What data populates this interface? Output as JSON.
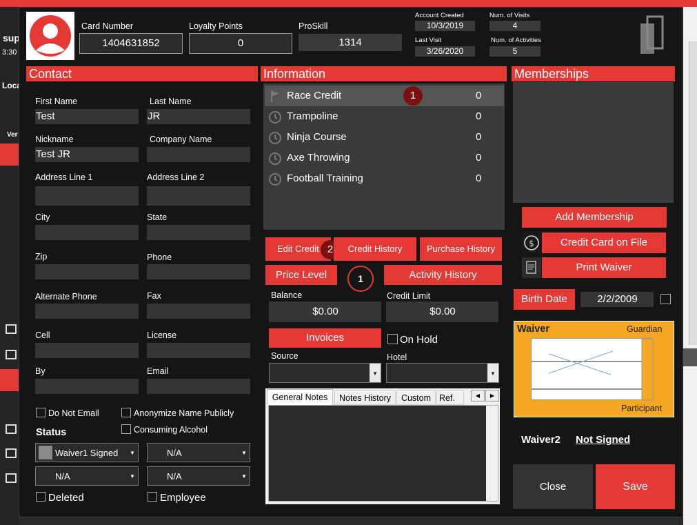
{
  "background": {
    "bg_text_1": "sup",
    "bg_text_2": "3:30",
    "bg_text_3": "Loca",
    "bg_text_4": "Ver"
  },
  "header": {
    "card_number_label": "Card Number",
    "card_number": "1404631852",
    "loyalty_label": "Loyalty Points",
    "loyalty": "0",
    "proskill_label": "ProSkill",
    "proskill": "1314",
    "account_created_label": "Account Created",
    "account_created": "10/3/2019",
    "last_visit_label": "Last Visit",
    "last_visit": "3/26/2020",
    "num_visits_label": "Num. of Visits",
    "num_visits": "4",
    "num_activities_label": "Num. of Activities",
    "num_activities": "5"
  },
  "contact": {
    "title": "Contact",
    "first_name_label": "First Name",
    "first_name": "Test",
    "last_name_label": "Last Name",
    "last_name": "JR",
    "nickname_label": "Nickname",
    "nickname": "Test JR",
    "company_label": "Company Name",
    "company": "",
    "address1_label": "Address Line 1",
    "address2_label": "Address Line 2",
    "city_label": "City",
    "state_label": "State",
    "zip_label": "Zip",
    "phone_label": "Phone",
    "alt_phone_label": "Alternate Phone",
    "fax_label": "Fax",
    "cell_label": "Cell",
    "license_label": "License",
    "by_label": "By",
    "email_label": "Email",
    "do_not_email": "Do Not Email",
    "anonymize": "Anonymize Name Publicly",
    "consuming_alcohol": "Consuming Alcohol",
    "status_label": "Status",
    "status_1": "Waiver1 Signed",
    "status_2": "N/A",
    "status_3": "N/A",
    "status_4": "N/A",
    "deleted": "Deleted",
    "employee": "Employee"
  },
  "information": {
    "title": "Information",
    "items": [
      {
        "name": "Race Credit",
        "count": "0",
        "icon": "flag-icon"
      },
      {
        "name": "Trampoline",
        "count": "0",
        "icon": "clock-icon"
      },
      {
        "name": "Ninja Course",
        "count": "0",
        "icon": "clock-icon"
      },
      {
        "name": "Axe Throwing",
        "count": "0",
        "icon": "clock-icon"
      },
      {
        "name": "Football Training",
        "count": "0",
        "icon": "clock-icon"
      }
    ],
    "badge_1": "1",
    "badge_2": "2",
    "badge_3": "1",
    "edit_credit": "Edit Credit",
    "credit_history": "Credit History",
    "purchase_history": "Purchase History",
    "price_level": "Price Level",
    "activity_history": "Activity History",
    "balance_label": "Balance",
    "balance": "$0.00",
    "credit_limit_label": "Credit Limit",
    "credit_limit": "$0.00",
    "invoices": "Invoices",
    "on_hold": "On Hold",
    "source_label": "Source",
    "hotel_label": "Hotel",
    "tabs": [
      "General Notes",
      "Notes History",
      "Custom",
      "Ref."
    ]
  },
  "memberships": {
    "title": "Memberships",
    "add_membership": "Add Membership",
    "credit_card": "Credit Card on File",
    "print_waiver": "Print Waiver",
    "birth_date_label": "Birth Date",
    "birth_date": "2/2/2009",
    "waiver_title": "Waiver",
    "guardian": "Guardian",
    "participant": "Participant",
    "waiver2_label": "Waiver2",
    "waiver2_status": "Not Signed",
    "close": "Close",
    "save": "Save"
  },
  "colors": {
    "accent": "#e53935",
    "waiver_bg": "#f5a623",
    "badge": "#7a1010"
  }
}
